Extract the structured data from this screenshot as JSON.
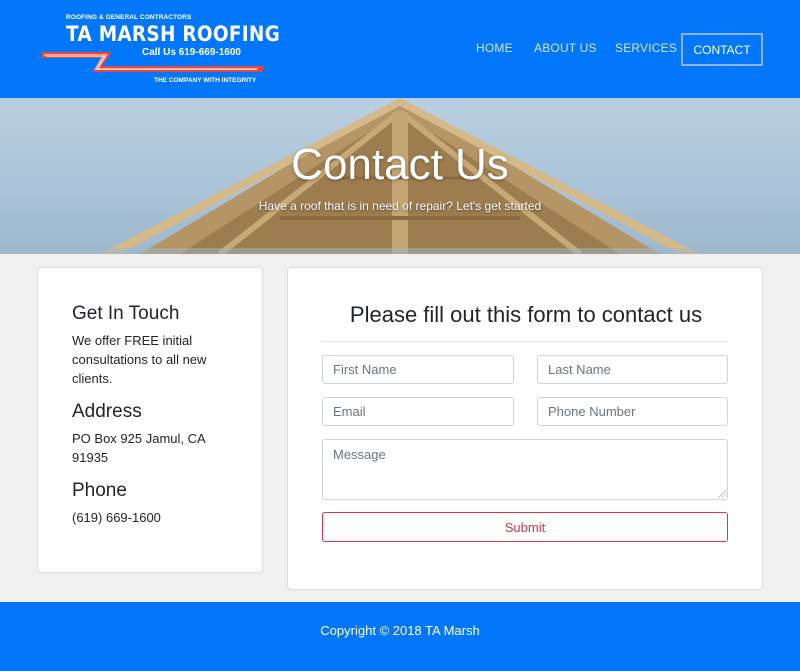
{
  "colors": {
    "brand_blue": "#0277fb",
    "danger": "#dc3545",
    "background": "#f0f0f0"
  },
  "logo": {
    "top_line": "ROOFING & GENERAL CONTRACTORS",
    "name": "TA MARSH ROOFING",
    "phone": "Call Us 619-669-1600",
    "tagline": "THE COMPANY WITH INTEGRITY"
  },
  "nav": {
    "items": [
      {
        "label": "HOME"
      },
      {
        "label": "ABOUT US"
      },
      {
        "label": "SERVICES"
      },
      {
        "label": "CONTACT",
        "active": true
      }
    ]
  },
  "hero": {
    "title": "Contact Us",
    "subtitle": "Have a roof that is in need of repair? Let's get started"
  },
  "info": {
    "touch_heading": "Get In Touch",
    "touch_text": "We offer FREE initial consultations to all new clients.",
    "address_heading": "Address",
    "address_text": "PO Box 925 Jamul, CA 91935",
    "phone_heading": "Phone",
    "phone_text": "(619) 669-1600"
  },
  "form": {
    "title": "Please fill out this form to contact us",
    "first_name": {
      "value": "",
      "placeholder": "First Name"
    },
    "last_name": {
      "value": "",
      "placeholder": "Last Name"
    },
    "email": {
      "value": "",
      "placeholder": "Email"
    },
    "phone": {
      "value": "",
      "placeholder": "Phone Number"
    },
    "message": {
      "value": "",
      "placeholder": "Message"
    },
    "submit_label": "Submit"
  },
  "footer": {
    "copyright": "Copyright © 2018 TA Marsh"
  }
}
